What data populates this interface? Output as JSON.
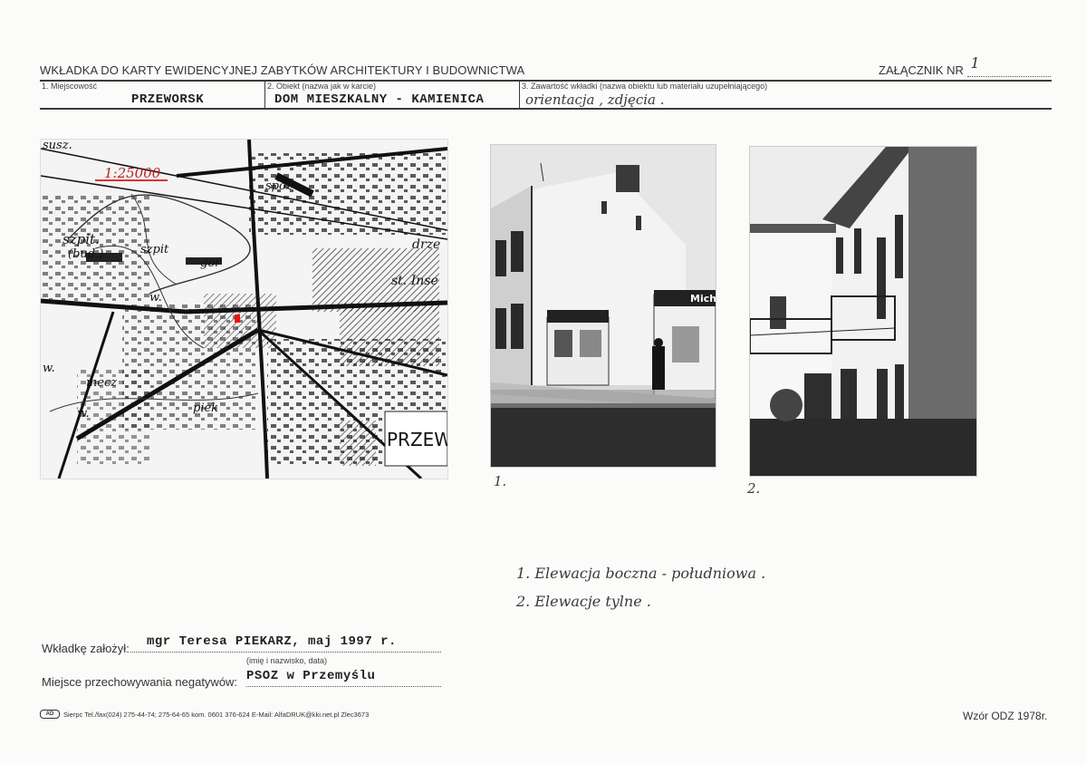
{
  "header": {
    "title": "WKŁADKA DO KARTY EWIDENCYJNEJ ZABYTKÓW ARCHITEKTURY I BUDOWNICTWA",
    "annex_label": "ZAŁĄCZNIK NR",
    "annex_number": "1"
  },
  "fields": {
    "f1_label": "1. Miejscowość",
    "f1_value": "PRZEWORSK",
    "f2_label": "2. Obiekt (nazwa jak w karcie)",
    "f2_value": "DOM MIESZKALNY - KAMIENICA",
    "f3_label": "3. Zawartość wkładki (nazwa obiektu lub materiału uzupełniającego)",
    "f3_value": "orientacja , zdjęcia ."
  },
  "map": {
    "scale": "1:25000",
    "labels": [
      "susz.",
      "spoz",
      "szpit.",
      "(bud.)",
      "szpit",
      "gor",
      "drze",
      "st. Inse",
      "w.",
      "w.",
      "w.",
      "mecz",
      "piek",
      "PRZEW"
    ]
  },
  "photos": {
    "p1_sign": "Mich",
    "p1_number": "1.",
    "p2_number": "2."
  },
  "captions": [
    "1. Elewacja boczna - południowa .",
    "2. Elewacje tylne ."
  ],
  "bottom": {
    "founder_label": "Wkładkę założył:",
    "founder_value": "mgr Teresa PIEKARZ, maj 1997 r.",
    "founder_hint": "(imię i nazwisko, data)",
    "storage_label": "Miejsce przechowywania negatywów:",
    "storage_value": "PSOZ w Przemyślu"
  },
  "footer": {
    "printer_logo": "AD",
    "printer_info": "Sierpc Tel./fax(024) 275-44-74; 275-64-65 kom. 0601 376-624   E-Mail: AlfaDRUK@kki.net.pl   Zlec3673",
    "model": "Wzór ODZ 1978r."
  },
  "colors": {
    "scale_mark": "#d33",
    "location_mark": "#e11"
  }
}
